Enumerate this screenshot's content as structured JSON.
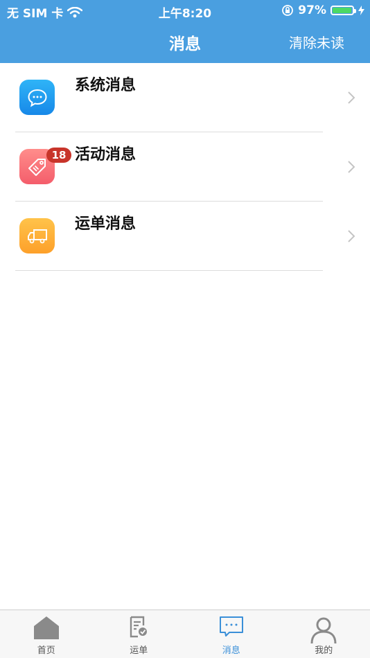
{
  "status_bar": {
    "carrier": "无 SIM 卡",
    "time": "上午8:20",
    "battery_percent": "97%",
    "battery_level": 0.97
  },
  "nav": {
    "title": "消息",
    "action": "清除未读"
  },
  "messages": [
    {
      "label": "系统消息",
      "icon": "chat-bubble-icon",
      "color": "#1e98ef"
    },
    {
      "label": "活动消息",
      "icon": "price-tag-icon",
      "color": "#f86b75"
    },
    {
      "label": "运单消息",
      "icon": "truck-icon",
      "color": "#feb03a",
      "badge": "18"
    }
  ],
  "tabbar": {
    "tabs": [
      {
        "label": "首页",
        "icon": "home-icon"
      },
      {
        "label": "运单",
        "icon": "waybill-icon"
      },
      {
        "label": "消息",
        "icon": "message-icon",
        "active": true
      },
      {
        "label": "我的",
        "icon": "profile-icon"
      }
    ]
  },
  "colors": {
    "header": "#4a9fe0",
    "active_tab": "#3a8fd8",
    "badge": "#c8342a"
  }
}
